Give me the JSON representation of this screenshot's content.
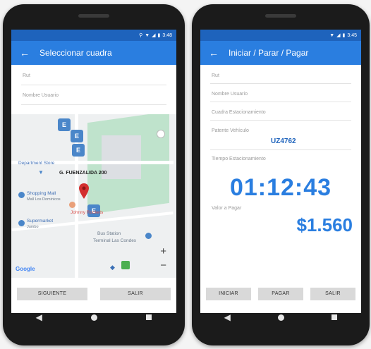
{
  "status_time": "3:48",
  "left": {
    "title": "Seleccionar cuadra",
    "fields": [
      "Rut",
      "Nombre Usuario"
    ],
    "map": {
      "pin_title": "G. FUENZALIDA 200",
      "labels": [
        "Department Store",
        "Shopping Mall",
        "Mall Los Dominicos",
        "Supermarket",
        "Jumbo",
        "Johnny Rockets",
        "Bus Station",
        "Terminal Las Condes"
      ],
      "markers": [
        "E",
        "E",
        "E",
        "E"
      ],
      "zoom_in": "+",
      "zoom_out": "−",
      "logo": "Google"
    },
    "buttons": [
      "SIGUIENTE",
      "SALIR"
    ]
  },
  "right": {
    "status_time": "3:45",
    "title": "Iniciar / Parar / Pagar",
    "fields": [
      "Rut",
      "Nombre Usuario",
      "Cuadra Estacionamiento",
      "Patente Vehículo",
      "Tiempo Estacionamiento",
      "Valor a Pagar"
    ],
    "plate": "UZ4762",
    "timer": "01:12:43",
    "amount": "$1.560",
    "buttons": [
      "INICIAR",
      "PAGAR",
      "SALIR"
    ]
  },
  "colors": {
    "primary": "#2a7ee0",
    "status": "#1e63bc",
    "accent_red": "#d32f2f"
  }
}
